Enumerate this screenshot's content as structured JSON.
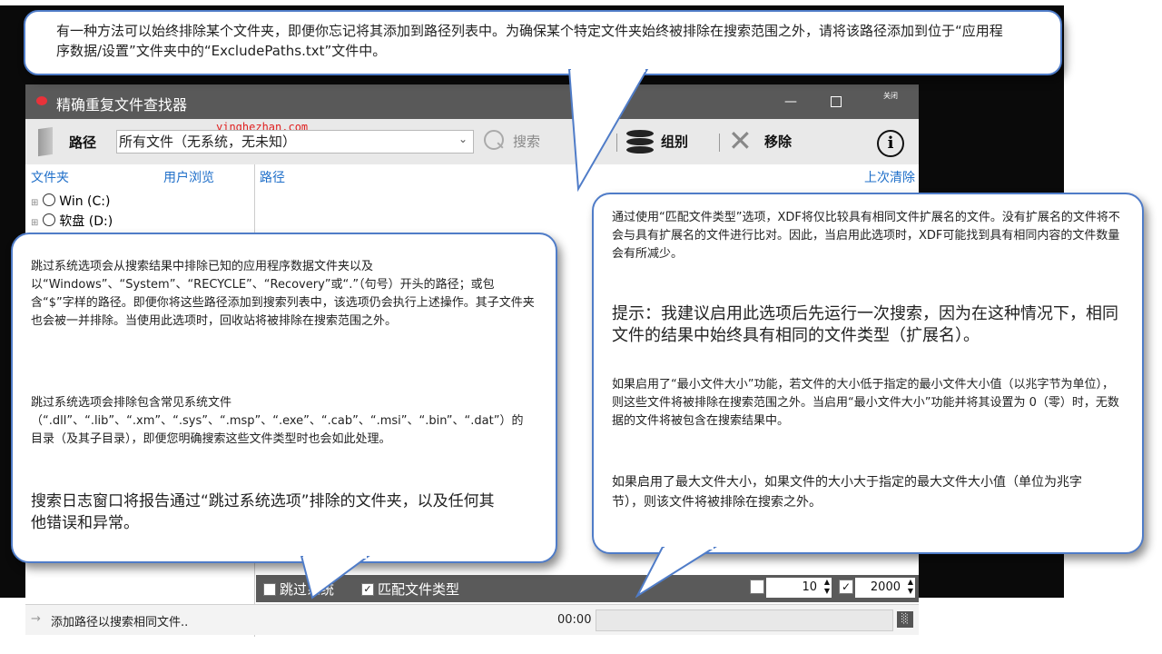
{
  "app": {
    "title": "精确重复文件查找器",
    "window_controls": {
      "close_label": "关闭"
    },
    "toolbar": {
      "path_label": "路径",
      "filter_value": "所有文件（无系统，无未知）",
      "search_label": "搜索",
      "group_label": "组别",
      "remove_label": "移除",
      "watermark": "yinghezhan.com"
    },
    "left_panel": {
      "header_folders": "文件夹",
      "header_browse": "用户浏览",
      "drives": [
        "Win (C:)",
        "软盘 (D:)"
      ]
    },
    "right_panel": {
      "header_path": "路径",
      "header_clear": "上次清除"
    },
    "bottom_bar": {
      "skip_system_label": "跳过系统",
      "match_type_label": "匹配文件类型",
      "min_size_value": "10",
      "max_size_value": "2000"
    },
    "status_bar": {
      "hint": "添加路径以搜索相同文件..",
      "time": "00:00"
    }
  },
  "callouts": {
    "top": "有一种方法可以始终排除某个文件夹，即便你忘记将其添加到路径列表中。为确保某个特定文件夹始终被排除在搜索范围之外，请将该路径添加到位于“应用程序数据/设置”文件夹中的“ExcludePaths.txt”文件中。",
    "left_p1": "跳过系统选项会从搜索结果中排除已知的应用程序数据文件夹以及以“Windows”、“System”、“RECYCLE”、“Recovery”或“.”（句号）开头的路径；或包含“$”字样的路径。即便你将这些路径添加到搜索列表中，该选项仍会执行上述操作。其子文件夹也会被一并排除。当使用此选项时，回收站将被排除在搜索范围之外。",
    "left_p2": "跳过系统选项会排除包含常见系统文件（“.dll”、“.lib”、“.xm”、“.sys”、“.msp”、“.exe”、“.cab”、“.msi”、“.bin”、“.dat”）的目录（及其子目录），即便您明确搜索这些文件类型时也会如此处理。",
    "left_p3": "搜索日志窗口将报告通过“跳过系统选项”排除的文件夹，以及任何其他错误和异常。",
    "right_p1": "通过使用“匹配文件类型”选项，XDF将仅比较具有相同文件扩展名的文件。没有扩展名的文件将不会与具有扩展名的文件进行比对。因此，当启用此选项时，XDF可能找到具有相同内容的文件数量会有所减少。",
    "right_p2": "提示：我建议启用此选项后先运行一次搜索，因为在这种情况下，相同文件的结果中始终具有相同的文件类型（扩展名）。",
    "right_p3": "如果启用了“最小文件大小”功能，若文件的大小低于指定的最小文件大小值（以兆字节为单位），则这些文件将被排除在搜索范围之外。当启用“最小文件大小”功能并将其设置为 0（零）时，无数据的文件将被包含在搜索结果中。",
    "right_p4": "如果启用了最大文件大小，如果文件的大小大于指定的最大文件大小值（单位为兆字节），则该文件将被排除在搜索之外。"
  },
  "colors": {
    "titlebar": "#595959",
    "toolbar": "#e9e9e9",
    "accent_blue": "#1f6fc9",
    "bubble_border": "#4f7cc8"
  }
}
